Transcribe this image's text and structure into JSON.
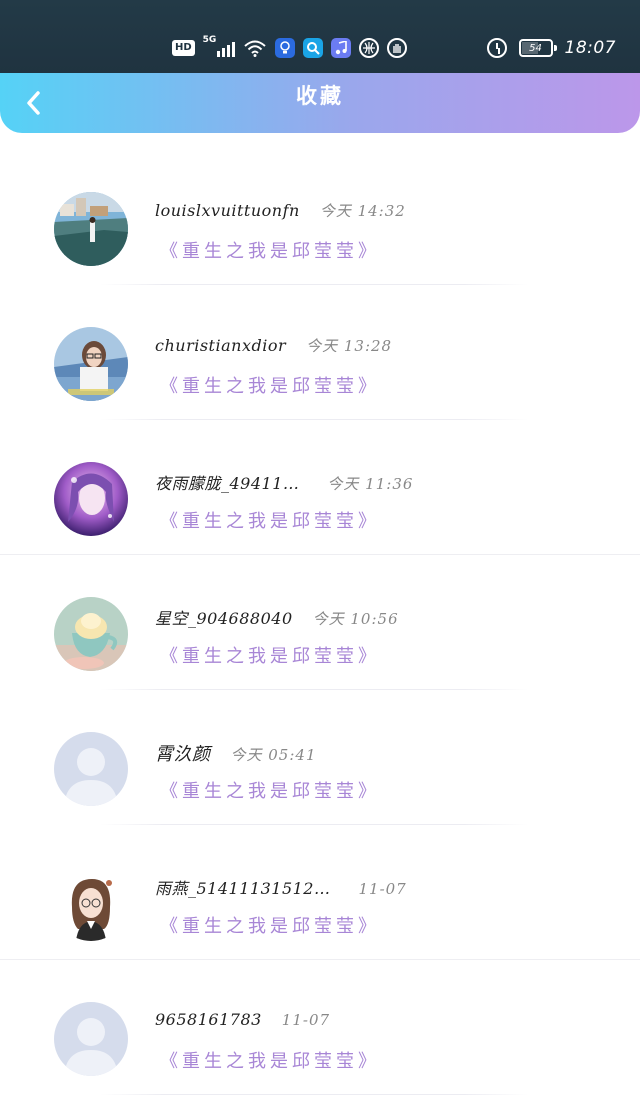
{
  "status_bar": {
    "hd": "HD",
    "network": "5G",
    "battery": "54",
    "time": "18:07"
  },
  "header": {
    "title": "收藏",
    "back_icon": "chevron-left-icon"
  },
  "favorites": [
    {
      "name": "louislxvuittuonfn",
      "time": "今天 14:32",
      "work": "《重生之我是邱莹莹》",
      "avatar": "photo-harbor"
    },
    {
      "name": "churistianxdior",
      "time": "今天 13:28",
      "work": "《重生之我是邱莹莹》",
      "avatar": "photo-girl-glasses"
    },
    {
      "name": "夜雨朦胧_49411…",
      "time": "今天 11:36",
      "work": "《重生之我是邱莹莹》",
      "avatar": "photo-purple-art"
    },
    {
      "name": "星空_904688040",
      "time": "今天 10:56",
      "work": "《重生之我是邱莹莹》",
      "avatar": "photo-teacup"
    },
    {
      "name": "霄汣颜",
      "time": "今天 05:41",
      "work": "《重生之我是邱莹莹》",
      "avatar": "default-avatar"
    },
    {
      "name": "雨燕_51411131512…",
      "time": "11-07",
      "work": "《重生之我是邱莹莹》",
      "avatar": "illustration-girl"
    },
    {
      "name": "9658161783",
      "time": "11-07",
      "work": "《重生之我是邱莹莹》",
      "avatar": "default-avatar"
    }
  ],
  "colors": {
    "header_start": "#55d2f6",
    "header_end": "#bc97ea",
    "work_title": "#a886d6"
  }
}
